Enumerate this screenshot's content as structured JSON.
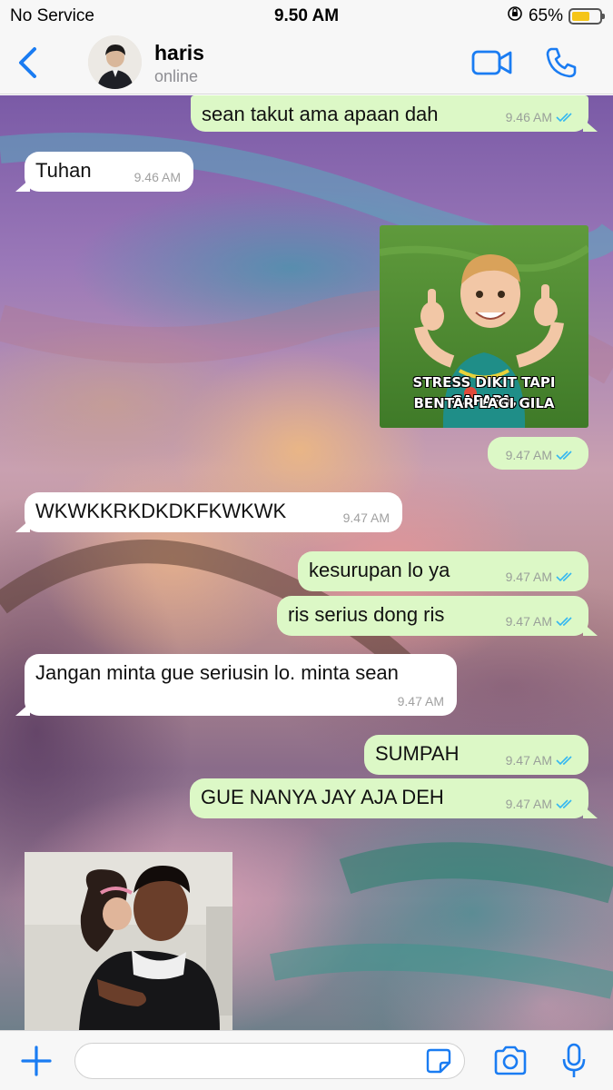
{
  "status_bar": {
    "carrier": "No Service",
    "time": "9.50 AM",
    "battery": "65%",
    "battery_level": 0.65
  },
  "header": {
    "contact_name": "haris",
    "contact_status": "online"
  },
  "messages": [
    {
      "dir": "out",
      "text": "sean takut ama apaan dah",
      "time": "9.46 AM"
    },
    {
      "dir": "in",
      "text": "Tuhan",
      "time": "9.46 AM"
    },
    {
      "dir": "out",
      "image": "meme-kid-thumbs-up",
      "caption_line1": "STRESS DIKIT TAPI GAPAPA,",
      "caption_line2": "BENTAR LAGI GILA",
      "time": "9.47 AM"
    },
    {
      "dir": "in",
      "text": "WKWKKRKDKDKFKWKWK",
      "time": "9.47 AM"
    },
    {
      "dir": "out",
      "text": "kesurupan lo ya",
      "time": "9.47 AM"
    },
    {
      "dir": "out",
      "text": "ris serius dong ris",
      "time": "9.47 AM"
    },
    {
      "dir": "in",
      "text": "Jangan minta gue seriusin lo. minta sean",
      "time": "9.47 AM"
    },
    {
      "dir": "out",
      "text": "SUMPAH",
      "time": "9.47 AM"
    },
    {
      "dir": "out",
      "text": "GUE NANYA JAY AJA DEH",
      "time": "9.47 AM"
    },
    {
      "dir": "in",
      "image": "meme-hug-photo"
    }
  ],
  "icons": {
    "back": "chevron-left-icon",
    "video": "video-camera-icon",
    "call": "phone-icon",
    "plus": "plus-icon",
    "sticker": "sticker-icon",
    "camera": "camera-icon",
    "mic": "microphone-icon",
    "read": "double-check-icon"
  },
  "input": {
    "value": ""
  },
  "colors": {
    "accent": "#1a7cf2",
    "outgoing_bubble": "#dcf8c6",
    "incoming_bubble": "#ffffff",
    "read_ticks": "#34b7f1"
  }
}
